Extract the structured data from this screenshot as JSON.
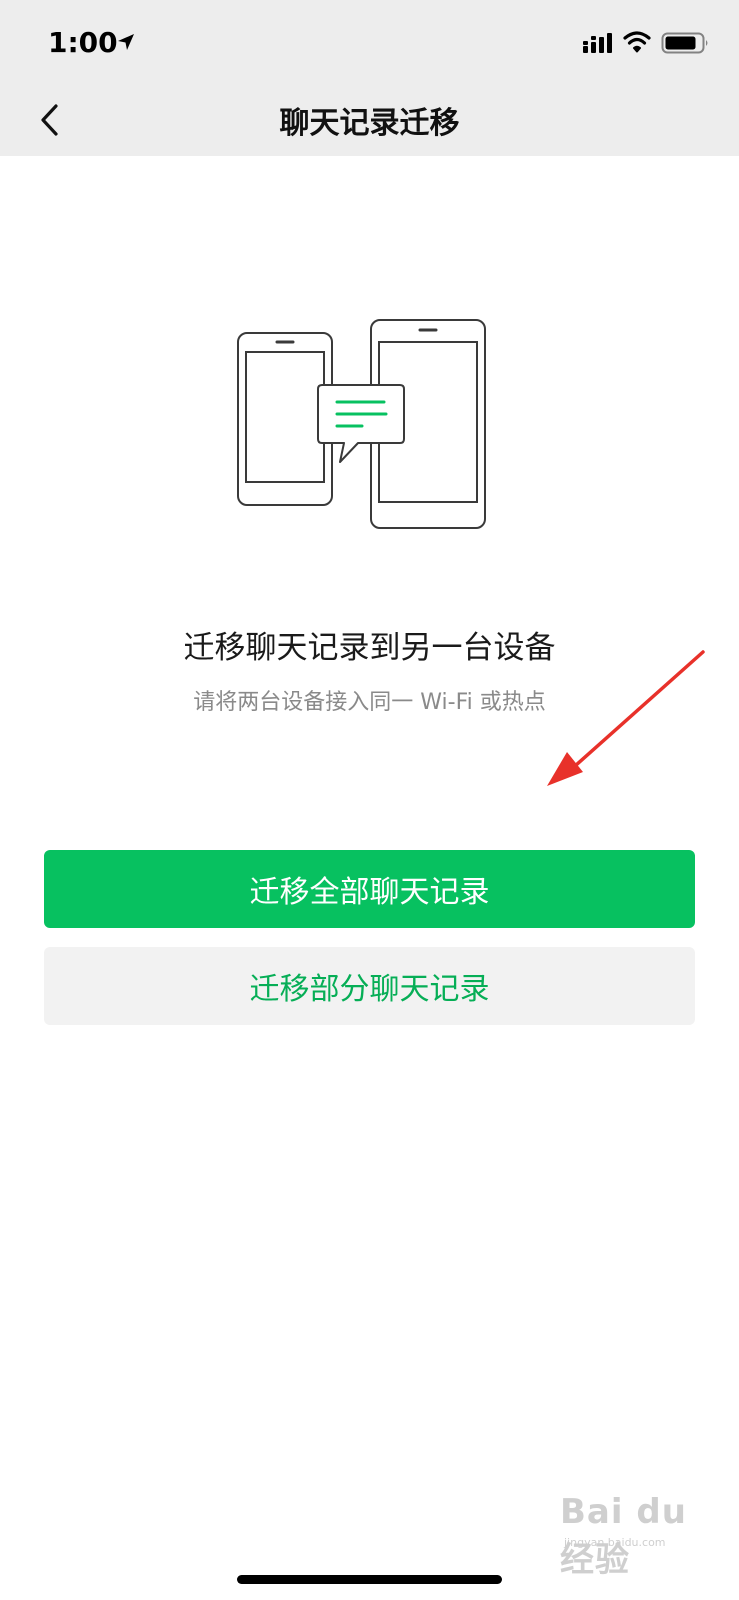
{
  "status_bar": {
    "time": "1:00"
  },
  "nav": {
    "title": "聊天记录迁移"
  },
  "content": {
    "headline": "迁移聊天记录到另一台设备",
    "subtitle": "请将两台设备接入同一 Wi-Fi 或热点"
  },
  "buttons": {
    "migrate_all": "迁移全部聊天记录",
    "migrate_partial": "迁移部分聊天记录"
  },
  "watermark": {
    "main": "Bai du 经验",
    "sub": "jingyan.baidu.com"
  },
  "colors": {
    "primary_green": "#07c160",
    "secondary_text_green": "#06ae56",
    "annotation_arrow": "#e8312a",
    "nav_background": "#ededed"
  },
  "icons": {
    "back": "chevron-left-icon",
    "location": "location-arrow-icon",
    "signal": "cellular-signal-icon",
    "wifi": "wifi-icon",
    "battery": "battery-icon",
    "illustration": "phones-transfer-illustration"
  }
}
